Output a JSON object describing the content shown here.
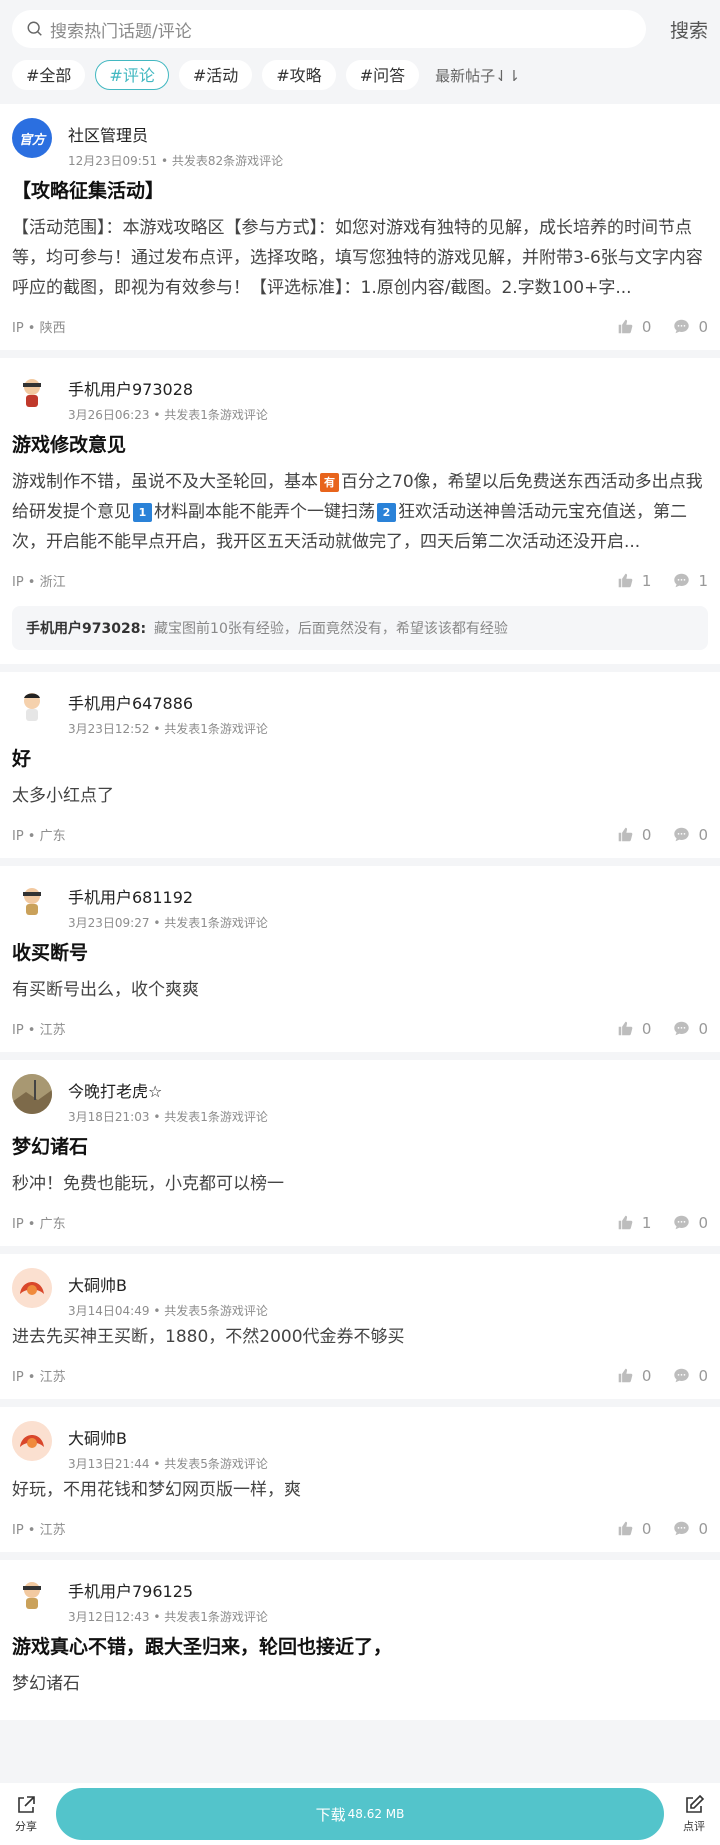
{
  "search": {
    "placeholder": "搜索热门话题/评论",
    "button": "搜索"
  },
  "tags": [
    "#全部",
    "#评论",
    "#活动",
    "#攻略",
    "#问答"
  ],
  "active_tag": "#评论",
  "sort_label": "最新帖子⇃⇂",
  "posts": [
    {
      "name": "社区管理员",
      "time": "12月23日09:51",
      "count": "共发表82条游戏评论",
      "title": "【攻略征集活动】",
      "content": "【活动范围】：本游戏攻略区【参与方式】：如您对游戏有独特的见解，成长培养的时间节点等，均可参与！通过发布点评，选择攻略，填写您独特的游戏见解，并附带3-6张与文字内容呼应的截图，即视为有效参与！【评选标准】：1.原创内容/截图。2.字数100+字...",
      "ip": "IP • 陕西",
      "likes": "0",
      "comments": "0"
    },
    {
      "name": "手机用户973028",
      "time": "3月26日06:23",
      "count": "共发表1条游戏评论",
      "title": "游戏修改意见",
      "content_parts": [
        "游戏制作不错，虽说不及大圣轮回，基本",
        "百分之70像，希望以后免费送东西活动多出点我给研发提个意见",
        "材料副本能不能弄个一键扫荡",
        "狂欢活动送神兽活动元宝充值送，第二次，开启能不能早点开启，我开区五天活动就做完了，四天后第二次活动还没开启..."
      ],
      "emojis": [
        "有",
        "1",
        "2"
      ],
      "ip": "IP • 浙江",
      "likes": "1",
      "comments": "1",
      "reply_name": "手机用户973028:",
      "reply_text": "藏宝图前10张有经验，后面竟然没有，希望该该都有经验"
    },
    {
      "name": "手机用户647886",
      "time": "3月23日12:52",
      "count": "共发表1条游戏评论",
      "title": "好",
      "content": "太多小红点了",
      "ip": "IP • 广东",
      "likes": "0",
      "comments": "0"
    },
    {
      "name": "手机用户681192",
      "time": "3月23日09:27",
      "count": "共发表1条游戏评论",
      "title": "收买断号",
      "content": "有买断号出么，收个爽爽",
      "ip": "IP • 江苏",
      "likes": "0",
      "comments": "0"
    },
    {
      "name": "今晚打老虎☆",
      "time": "3月18日21:03",
      "count": "共发表1条游戏评论",
      "title": "梦幻诸石",
      "content": "秒冲！免费也能玩，小克都可以榜一",
      "ip": "IP • 广东",
      "likes": "1",
      "comments": "0"
    },
    {
      "name": "大硐帅B",
      "time": "3月14日04:49",
      "count": "共发表5条游戏评论",
      "content": "进去先买神王买断，1880，不然2000代金券不够买",
      "ip": "IP • 江苏",
      "likes": "0",
      "comments": "0"
    },
    {
      "name": "大硐帅B",
      "time": "3月13日21:44",
      "count": "共发表5条游戏评论",
      "content": "好玩，不用花钱和梦幻网页版一样，爽",
      "ip": "IP • 江苏",
      "likes": "0",
      "comments": "0"
    },
    {
      "name": "手机用户796125",
      "time": "3月12日12:43",
      "count": "共发表1条游戏评论",
      "title": "游戏真心不错，跟大圣归来，轮回也接近了，",
      "content": "梦幻诸石"
    }
  ],
  "official_badge": "官方",
  "bottom": {
    "share": "分享",
    "download": "下载",
    "size": "48.62 MB",
    "review": "点评"
  },
  "colors": {
    "accent": "#53c4cb",
    "tag_active": "#42b8c1"
  }
}
